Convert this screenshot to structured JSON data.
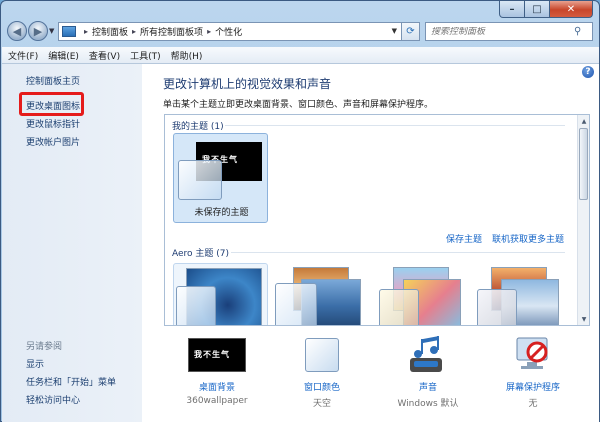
{
  "window": {
    "buttons": {
      "minimize": "–",
      "maximize": "□",
      "close": "✕"
    }
  },
  "nav": {
    "back_icon": "back-arrow-icon",
    "forward_icon": "forward-arrow-icon",
    "breadcrumb": [
      "控制面板",
      "所有控制面板项",
      "个性化"
    ],
    "search_placeholder": "搜索控制面板"
  },
  "menu": [
    "文件(F)",
    "编辑(E)",
    "查看(V)",
    "工具(T)",
    "帮助(H)"
  ],
  "sidebar": {
    "links": [
      "控制面板主页",
      "更改桌面图标",
      "更改鼠标指针",
      "更改帐户图片"
    ],
    "see_also_title": "另请参阅",
    "see_also": [
      "显示",
      "任务栏和「开始」菜单",
      "轻松访问中心"
    ]
  },
  "main": {
    "title": "更改计算机上的视觉效果和声音",
    "subtitle": "单击某个主题立即更改桌面背景、窗口颜色、声音和屏幕保护程序。",
    "my_themes_header": "我的主题 (1)",
    "unsaved_theme": {
      "name": "未保存的主题",
      "thumb_text": "我不生气"
    },
    "save_theme_link": "保存主题",
    "get_more_link": "联机获取更多主题",
    "aero_header": "Aero 主题 (7)"
  },
  "tray": [
    {
      "label": "桌面背景",
      "value": "360wallpaper",
      "icon": "desktop-background-icon",
      "thumb_text": "我不生气"
    },
    {
      "label": "窗口颜色",
      "value": "天空",
      "icon": "window-color-icon"
    },
    {
      "label": "声音",
      "value": "Windows 默认",
      "icon": "music-notes-icon"
    },
    {
      "label": "屏幕保护程序",
      "value": "无",
      "icon": "screensaver-none-icon"
    }
  ],
  "colors": {
    "accent_link": "#1766c7",
    "title_blue": "#1e3c72",
    "highlight": "#e51b1b"
  }
}
